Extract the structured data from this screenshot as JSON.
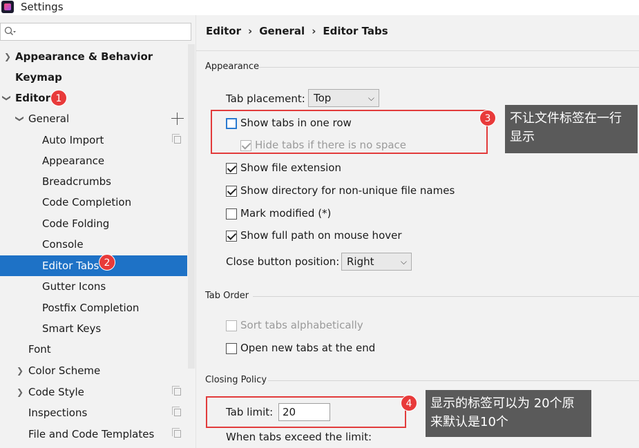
{
  "window": {
    "title": "Settings"
  },
  "sidebar": {
    "search_placeholder": "",
    "items": [
      {
        "label": "Appearance & Behavior",
        "badge": ""
      },
      {
        "label": "Keymap",
        "badge": ""
      },
      {
        "label": "Editor",
        "badge": "1"
      },
      {
        "label": "General",
        "badge": ""
      },
      {
        "label": "Auto Import",
        "badge": ""
      },
      {
        "label": "Appearance",
        "badge": ""
      },
      {
        "label": "Breadcrumbs",
        "badge": ""
      },
      {
        "label": "Code Completion",
        "badge": ""
      },
      {
        "label": "Code Folding",
        "badge": ""
      },
      {
        "label": "Console",
        "badge": ""
      },
      {
        "label": "Editor Tabs",
        "badge": "2"
      },
      {
        "label": "Gutter Icons",
        "badge": ""
      },
      {
        "label": "Postfix Completion",
        "badge": ""
      },
      {
        "label": "Smart Keys",
        "badge": ""
      },
      {
        "label": "Font",
        "badge": ""
      },
      {
        "label": "Color Scheme",
        "badge": ""
      },
      {
        "label": "Code Style",
        "badge": ""
      },
      {
        "label": "Inspections",
        "badge": ""
      },
      {
        "label": "File and Code Templates",
        "badge": ""
      }
    ]
  },
  "main": {
    "breadcrumb": [
      "Editor",
      "General",
      "Editor Tabs"
    ],
    "breadcrumb_sep": "›",
    "appearance": {
      "title": "Appearance",
      "tab_placement_label": "Tab placement:",
      "tab_placement_value": "Top",
      "show_tabs_one_row": {
        "label": "Show tabs in one row",
        "checked": false
      },
      "hide_tabs_no_space": {
        "label": "Hide tabs if there is no space",
        "checked": true,
        "disabled": true
      },
      "show_file_extension": {
        "label": "Show file extension",
        "checked": true
      },
      "show_directory": {
        "label": "Show directory for non-unique file names",
        "checked": true
      },
      "mark_modified": {
        "label": "Mark modified (*)",
        "checked": false
      },
      "show_full_path": {
        "label": "Show full path on mouse hover",
        "checked": true
      },
      "close_button_label": "Close button position:",
      "close_button_value": "Right"
    },
    "tab_order": {
      "title": "Tab Order",
      "sort_alpha": {
        "label": "Sort tabs alphabetically",
        "checked": false,
        "disabled": true
      },
      "open_at_end": {
        "label": "Open new tabs at the end",
        "checked": false
      }
    },
    "closing_policy": {
      "title": "Closing Policy",
      "tab_limit_label": "Tab limit:",
      "tab_limit_value": "20",
      "exceed_label": "When tabs exceed the limit:"
    }
  },
  "annotations": {
    "badge3": "3",
    "badge4": "4",
    "note3": "不让文件标签在一行显示",
    "note4": "显示的标签可以为 20个原来默认是10个"
  },
  "colors": {
    "selection": "#1e72c6",
    "badge": "#e83a3a",
    "callout_bg": "#5a5a5a",
    "highlight_box": "#e23b3b"
  }
}
